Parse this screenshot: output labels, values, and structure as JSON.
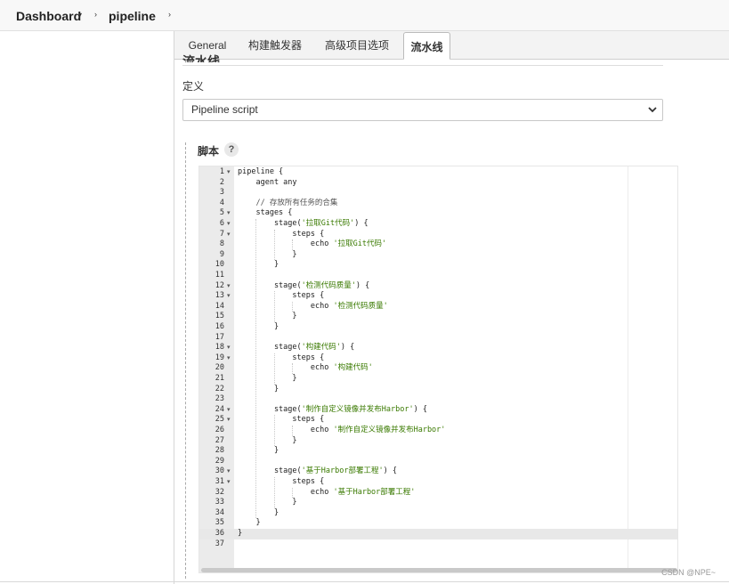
{
  "breadcrumb": {
    "dashboard": "Dashboard",
    "dashboard_caret": "▾",
    "separator": "›",
    "job": "pipeline"
  },
  "tabs": [
    {
      "label": "General"
    },
    {
      "label": "构建触发器"
    },
    {
      "label": "高级项目选项"
    },
    {
      "label": "流水线",
      "active": true
    }
  ],
  "section": {
    "heading": "流水线",
    "definition_label": "定义",
    "definition_value": "Pipeline script",
    "script_label": "脚本",
    "help": "?"
  },
  "editor": {
    "current_line": 36,
    "lines": [
      {
        "n": "1",
        "fold": true,
        "text": "pipeline {"
      },
      {
        "n": "2",
        "text": "    agent any"
      },
      {
        "n": "3",
        "text": ""
      },
      {
        "n": "4",
        "text": "    // 存放所有任务的合集",
        "comment": true
      },
      {
        "n": "5",
        "fold": true,
        "text": "    stages {"
      },
      {
        "n": "6",
        "fold": true,
        "pre": "        stage(",
        "str": "'拉取Git代码'",
        "post": ") {"
      },
      {
        "n": "7",
        "fold": true,
        "text": "            steps {"
      },
      {
        "n": "8",
        "pre": "                echo ",
        "str": "'拉取Git代码'",
        "post": ""
      },
      {
        "n": "9",
        "text": "            }"
      },
      {
        "n": "10",
        "text": "        }"
      },
      {
        "n": "11",
        "text": ""
      },
      {
        "n": "12",
        "fold": true,
        "pre": "        stage(",
        "str": "'检测代码质量'",
        "post": ") {"
      },
      {
        "n": "13",
        "fold": true,
        "text": "            steps {"
      },
      {
        "n": "14",
        "pre": "                echo ",
        "str": "'检测代码质量'",
        "post": ""
      },
      {
        "n": "15",
        "text": "            }"
      },
      {
        "n": "16",
        "text": "        }"
      },
      {
        "n": "17",
        "text": ""
      },
      {
        "n": "18",
        "fold": true,
        "pre": "        stage(",
        "str": "'构建代码'",
        "post": ") {"
      },
      {
        "n": "19",
        "fold": true,
        "text": "            steps {"
      },
      {
        "n": "20",
        "pre": "                echo ",
        "str": "'构建代码'",
        "post": ""
      },
      {
        "n": "21",
        "text": "            }"
      },
      {
        "n": "22",
        "text": "        }"
      },
      {
        "n": "23",
        "text": ""
      },
      {
        "n": "24",
        "fold": true,
        "pre": "        stage(",
        "str": "'制作自定义镜像并发布Harbor'",
        "post": ") {"
      },
      {
        "n": "25",
        "fold": true,
        "text": "            steps {"
      },
      {
        "n": "26",
        "pre": "                echo ",
        "str": "'制作自定义镜像并发布Harbor'",
        "post": ""
      },
      {
        "n": "27",
        "text": "            }"
      },
      {
        "n": "28",
        "text": "        }"
      },
      {
        "n": "29",
        "text": ""
      },
      {
        "n": "30",
        "fold": true,
        "pre": "        stage(",
        "str": "'基于Harbor部署工程'",
        "post": ") {"
      },
      {
        "n": "31",
        "fold": true,
        "text": "            steps {"
      },
      {
        "n": "32",
        "pre": "                echo ",
        "str": "'基于Harbor部署工程'",
        "post": ""
      },
      {
        "n": "33",
        "text": "            }"
      },
      {
        "n": "34",
        "text": "        }"
      },
      {
        "n": "35",
        "text": "    }"
      },
      {
        "n": "36",
        "text": "}"
      },
      {
        "n": "37",
        "text": ""
      }
    ]
  },
  "watermark": "CSDN @NPE~",
  "icons": {
    "fold": "fold-arrow-icon",
    "help": "help-icon",
    "select": "chevron-down-icon"
  }
}
